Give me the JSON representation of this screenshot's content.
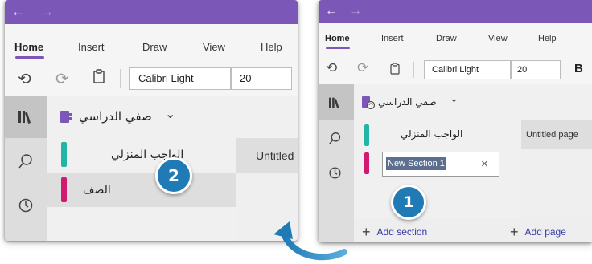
{
  "colors": {
    "titlebar": "#7b57b8",
    "accent_underline": "#7b57b8",
    "badge": "#1f7ab6",
    "tab_teal": "#22b5a6",
    "tab_magenta": "#d0196f",
    "link": "#3a3aa8"
  },
  "icons": {
    "back": "←",
    "forward": "→",
    "undo": "⟲",
    "redo": "⟳",
    "clipboard": "📋",
    "notebooks": "library-icon",
    "search": "⌕",
    "recent": "clock-icon",
    "chevron": "⌄",
    "close": "×",
    "plus": "+"
  },
  "left": {
    "menu": [
      "Home",
      "Insert",
      "Draw",
      "View",
      "Help"
    ],
    "font_name": "Calibri Light",
    "font_size": "20",
    "notebook_title": "صفي الدراسي",
    "sections": [
      "الواجب المنزلي",
      "الصف"
    ],
    "page_item": "Untitled",
    "badge": "2"
  },
  "right": {
    "menu": [
      "Home",
      "Insert",
      "Draw",
      "View",
      "Help"
    ],
    "font_name": "Calibri Light",
    "font_size": "20",
    "bold": "B",
    "notebook_title": "صفي الدراسي",
    "sections": [
      "الواجب المنزلي"
    ],
    "new_section_value": "New Section 1",
    "page_item": "Untitled page",
    "add_section": "Add section",
    "add_page": "Add page",
    "badge": "1"
  }
}
